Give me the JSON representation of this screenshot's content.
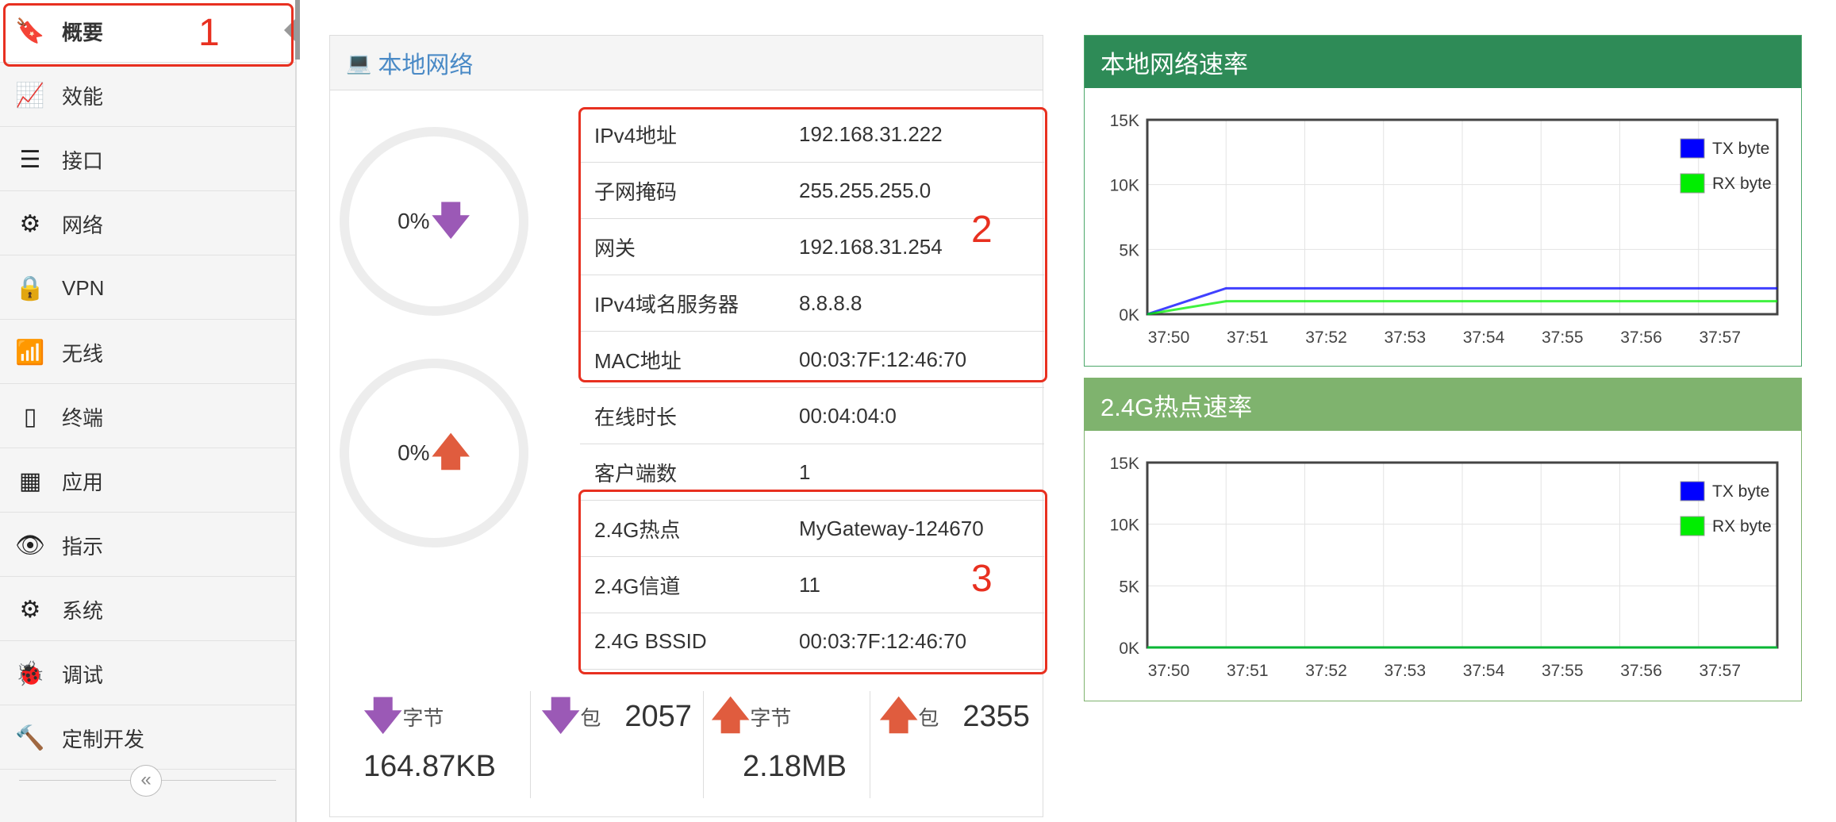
{
  "sidebar": {
    "items": [
      {
        "label": "概要",
        "icon": "bookmark-icon",
        "active": true
      },
      {
        "label": "效能",
        "icon": "area-chart-icon"
      },
      {
        "label": "接口",
        "icon": "list-icon"
      },
      {
        "label": "网络",
        "icon": "sitemap-icon"
      },
      {
        "label": "VPN",
        "icon": "lock-icon"
      },
      {
        "label": "无线",
        "icon": "wifi-icon"
      },
      {
        "label": "终端",
        "icon": "mobile-icon"
      },
      {
        "label": "应用",
        "icon": "building-icon"
      },
      {
        "label": "指示",
        "icon": "eye-icon"
      },
      {
        "label": "系统",
        "icon": "gears-icon"
      },
      {
        "label": "调试",
        "icon": "bug-icon"
      },
      {
        "label": "定制开发",
        "icon": "gavel-icon"
      }
    ],
    "collapse_glyph": "«"
  },
  "local_network": {
    "title": "本地网络",
    "download_gauge": "0%",
    "upload_gauge": "0%",
    "rows": [
      {
        "label": "IPv4地址",
        "value": "192.168.31.222"
      },
      {
        "label": "子网掩码",
        "value": "255.255.255.0"
      },
      {
        "label": "网关",
        "value": "192.168.31.254"
      },
      {
        "label": "IPv4域名服务器",
        "value": "8.8.8.8"
      },
      {
        "label": "MAC地址",
        "value": "00:03:7F:12:46:70"
      },
      {
        "label": "在线时长",
        "value": "00:04:04:0"
      },
      {
        "label": "客户端数",
        "value": "1"
      },
      {
        "label": "2.4G热点",
        "value": "MyGateway-124670"
      },
      {
        "label": "2.4G信道",
        "value": "11"
      },
      {
        "label": "2.4G BSSID",
        "value": "00:03:7F:12:46:70"
      }
    ],
    "stats": {
      "rx_bytes_label": "字节",
      "rx_bytes_value": "164.87KB",
      "rx_packets_label": "包",
      "rx_packets_value": "2057",
      "tx_bytes_label": "字节",
      "tx_bytes_value": "2.18MB",
      "tx_packets_label": "包",
      "tx_packets_value": "2355"
    }
  },
  "annotations": [
    "1",
    "2",
    "3"
  ],
  "colors": {
    "accent_blue": "#4a8ac6",
    "header_green_dark": "#2e8b57",
    "header_green_light": "#7fb36e",
    "annotation_red": "#e83020",
    "arrow_purple": "#9b59b6",
    "arrow_red": "#e05c3e",
    "tx_line": "#0000ff",
    "rx_line": "#00ee00"
  },
  "chart_data": [
    {
      "type": "line",
      "title": "本地网络速率",
      "x": [
        "37:50",
        "37:51",
        "37:52",
        "37:53",
        "37:54",
        "37:55",
        "37:56",
        "37:57"
      ],
      "y_ticks": [
        "15K",
        "10K",
        "5K",
        "0K"
      ],
      "ylim": [
        0,
        15000
      ],
      "series": [
        {
          "name": "TX byte",
          "values": [
            0,
            2000,
            2000,
            2000,
            2000,
            2000,
            2000,
            2000,
            2000
          ]
        },
        {
          "name": "RX byte",
          "values": [
            0,
            1000,
            1000,
            1000,
            1000,
            1000,
            1000,
            1000,
            1000
          ]
        }
      ],
      "legend": "top-right",
      "grid": true
    },
    {
      "type": "line",
      "title": "2.4G热点速率",
      "x": [
        "37:50",
        "37:51",
        "37:52",
        "37:53",
        "37:54",
        "37:55",
        "37:56",
        "37:57"
      ],
      "y_ticks": [
        "15K",
        "10K",
        "5K",
        "0K"
      ],
      "ylim": [
        0,
        15000
      ],
      "series": [
        {
          "name": "TX byte",
          "values": [
            0,
            0,
            0,
            0,
            0,
            0,
            0,
            0,
            0
          ]
        },
        {
          "name": "RX byte",
          "values": [
            0,
            0,
            0,
            0,
            0,
            0,
            0,
            0,
            0
          ]
        }
      ],
      "legend": "top-right",
      "grid": true
    }
  ]
}
